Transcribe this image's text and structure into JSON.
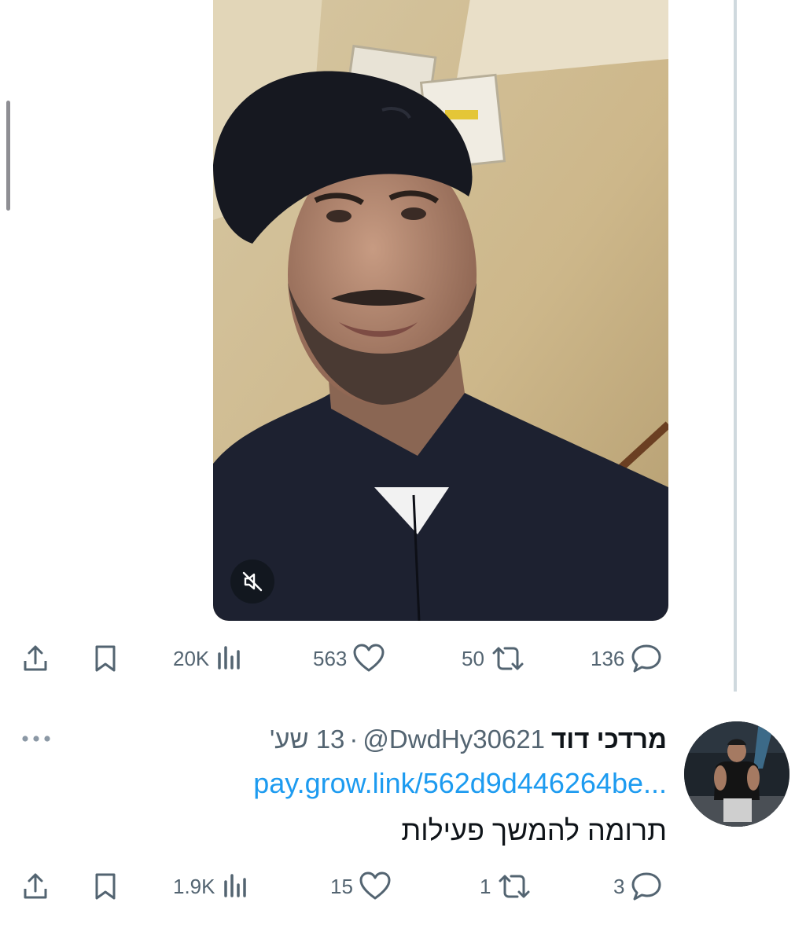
{
  "media": {
    "mute_icon": "speaker-muted-icon"
  },
  "tweet1": {
    "actions": {
      "replies": "136",
      "reposts": "50",
      "likes": "563",
      "views": "20K"
    }
  },
  "tweet2": {
    "author_name": "מרדכי דוד",
    "handle": "@DwdHy30621",
    "separator": "·",
    "time": "13 שע'",
    "link_text": "pay.grow.link/562d9d446264be...",
    "text": "תרומה להמשך פעילות",
    "actions": {
      "replies": "3",
      "reposts": "1",
      "likes": "15",
      "views": "1.9K"
    }
  },
  "colors": {
    "text_primary": "#0f1419",
    "text_secondary": "#536471",
    "link": "#1d9bf0",
    "thread_line": "#cfd9de"
  }
}
